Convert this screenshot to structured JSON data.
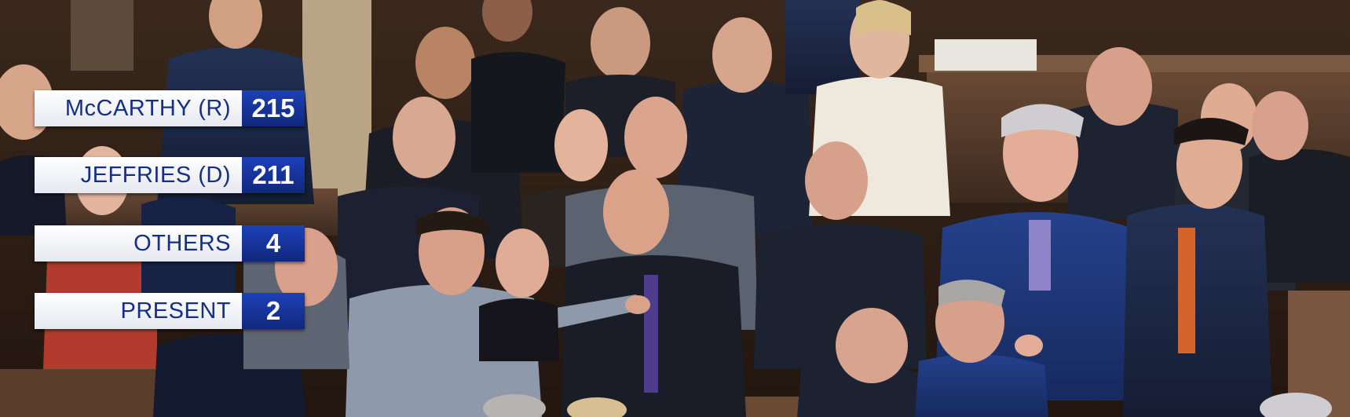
{
  "vote_tally": [
    {
      "name": "McCARTHY (R)",
      "count": "215"
    },
    {
      "name": "JEFFRIES (D)",
      "count": "211"
    },
    {
      "name": "OTHERS",
      "count": "4"
    },
    {
      "name": "PRESENT",
      "count": "2"
    }
  ],
  "colors": {
    "label_bg": "#ffffff",
    "label_text": "#142f88",
    "count_bg": "#1d40b8",
    "count_text": "#ffffff"
  }
}
